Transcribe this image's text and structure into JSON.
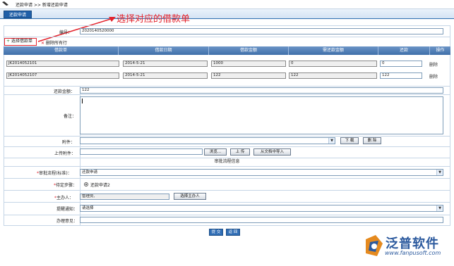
{
  "breadcrumb": {
    "part1": "还款申请",
    "sep": ">>",
    "part2": "新增还款申请"
  },
  "tab": {
    "label": "还款申请"
  },
  "annotation": {
    "text": "选择对应的借款单"
  },
  "form": {
    "number_label": "编号：",
    "number_value": "2020140520000",
    "select_loan_label": "选择借款单",
    "delete_selected_label": "删除所有行"
  },
  "table": {
    "headers": [
      "借款单",
      "借款日期",
      "借款金额",
      "需还款金额",
      "还款",
      "操作"
    ],
    "rows": [
      {
        "loan": "JK2014052101",
        "date": "2014-5-21",
        "amount": "1000",
        "due": "0",
        "repay": "0",
        "action": "删除"
      },
      {
        "loan": "JK2014052107",
        "date": "2014-5-21",
        "amount": "122",
        "due": "122",
        "repay": "122",
        "action": "删除"
      }
    ]
  },
  "total": {
    "label": "还款金额：",
    "value": "122"
  },
  "remark": {
    "label": "备注："
  },
  "attachment": {
    "label": "附件：",
    "btn_download": "下 载",
    "btn_delete": "删 除"
  },
  "upload": {
    "label": "上传附件：",
    "btn_browse": "浏览...",
    "btn_upload": "上 传",
    "btn_fromdoc": "从文档中导入"
  },
  "approval": {
    "section_title": "审批流程信息",
    "flow_label": "审批流程(标准)：",
    "flow_value": "还款申请",
    "step_label": "待定步骤：",
    "step_value": "还款申请2",
    "handler_label": "主办人：",
    "handler_value": "管理员,",
    "handler_btn": "选择主办人",
    "reminder_label": "提醒通知：",
    "reminder_value": "请选择",
    "opinion_label": "办理意见："
  },
  "actions": {
    "submit": "提 交",
    "back": "返 回"
  },
  "brand": {
    "name": "泛普软件",
    "url": "www.fanpusoft.com",
    "color": "#2c5a9e"
  }
}
